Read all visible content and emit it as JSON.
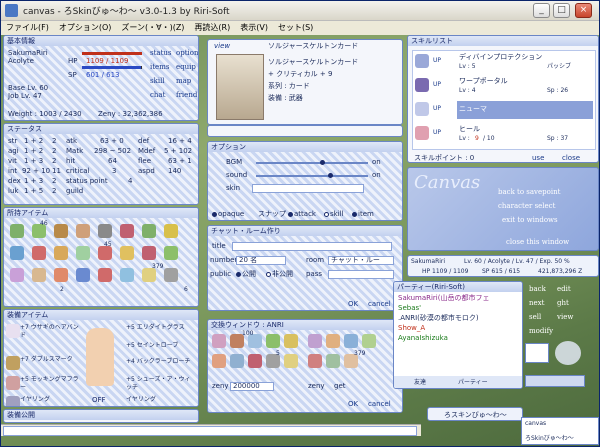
{
  "window": {
    "title": "canvas - ろSkinびゅ〜わ〜 v3.0-1.3 by Riri-Soft",
    "min": "_",
    "max": "□",
    "close": "×"
  },
  "menu": [
    "ファイル(F)",
    "オプション(O)",
    "ズーン(・∀・)(Z)",
    "再読込(R)",
    "表示(V)",
    "セット(S)"
  ],
  "basic": {
    "title": "基本情報",
    "name": "SakumaRiri",
    "job": "Acolyte",
    "hp_label": "HP",
    "hp": "1109 / 1109",
    "sp_label": "SP",
    "sp": "601 / 613",
    "base_lv": "Base Lv. 60",
    "job_lv": "Job Lv. 47",
    "weight": "Weight : 1003 / 2430",
    "zeny": "Zeny : 32,362,386",
    "hp_ratio": 1.0,
    "sp_ratio": 0.98,
    "buttons": [
      "status",
      "option",
      "items",
      "equip",
      "skill",
      "map",
      "chat",
      "friend"
    ]
  },
  "status": {
    "title": "ステータス",
    "rows": [
      [
        "str",
        "1 + 2",
        "2",
        "atk",
        "63 + 0",
        "def",
        "16 + 4"
      ],
      [
        "agi",
        "1 + 2",
        "2",
        "Matk",
        "298 ~ 502",
        "Mdef",
        "5 + 102"
      ],
      [
        "vit",
        "1 + 3",
        "2",
        "hit",
        "64",
        "flee",
        "63 + 1"
      ],
      [
        "int",
        "92 + 10",
        "11",
        "critical",
        "3",
        "aspd",
        "140"
      ],
      [
        "dex",
        "1 + 3",
        "2",
        "status point",
        "4",
        "",
        ""
      ],
      [
        "luk",
        "1 + 5",
        "2",
        "guild",
        "",
        "",
        ""
      ]
    ]
  },
  "inventory": {
    "title": "所持アイテム",
    "counts": [
      "46",
      "45",
      "379",
      "2",
      "6"
    ]
  },
  "equip": {
    "title": "装備アイテム",
    "left": [
      "+7 ウサギのヘアバンド",
      "+7 ダブルスマーク",
      "+5 モッキングマフラー",
      "イヤリング"
    ],
    "right": [
      "+5 エリダイトグラス",
      "+5 セイントローブ",
      "+4 バックラーブローチ",
      "+5 シューズ・ア・ウィッチ",
      "イヤリング"
    ],
    "off_label": "OFF"
  },
  "equip_public": {
    "title": "装備公開"
  },
  "card": {
    "view": "view",
    "title": "ソルジャースケルトンカード",
    "name": "ソルジャースケルトンカード",
    "effect": "+ クリティカル + 9",
    "series": "系列 : カード",
    "slot": "装備 : 武器"
  },
  "options": {
    "title": "オプション",
    "bgm": "BGM",
    "sound": "sound",
    "skin": "skin",
    "on": "on",
    "opaque": "opaque",
    "snap": "スナップ",
    "attack": "attack",
    "skill": "skill",
    "item": "item"
  },
  "chatroom": {
    "title": "チャット・ルーム作り",
    "title_label": "title",
    "number_label": "number",
    "number_value": "20 名",
    "room_label": "room",
    "room_value": "チャット・ルー",
    "public_label": "public",
    "public_opt": "公開",
    "private_opt": "非公開",
    "pass_label": "pass",
    "ok": "OK",
    "cancel": "cancel"
  },
  "trade": {
    "title": "交換ウィンドウ : ANRI",
    "zeny_label": "zeny",
    "zeny_value": "200000",
    "zeny_label2": "zeny",
    "get_label": "get",
    "ok": "OK",
    "cancel": "cancel",
    "counts": [
      "100",
      "5",
      "379"
    ]
  },
  "skills": {
    "title": "スキルリスト",
    "up": "UP",
    "items": [
      {
        "name": "ディバインプロテクション",
        "lv": "Lv : 5",
        "sp": "パッシブ",
        "icon": "shield-icon"
      },
      {
        "name": "ワープポータル",
        "lv": "Lv : 4",
        "sp": "Sp : 26",
        "icon": "portal-icon"
      },
      {
        "name": "ニューマ",
        "lv": "",
        "sp": "",
        "icon": "pneuma-icon"
      },
      {
        "name": "ヒール",
        "lv": "Lv :",
        "lv_cur": "9",
        "lv_max": "/ 10",
        "sp": "Sp : 37",
        "icon": "heal-icon"
      }
    ],
    "points": "スキルポイント : 0",
    "use": "use",
    "close": "close"
  },
  "canvas_menu": {
    "art": "Canvas",
    "items": [
      "back to savepoint",
      "character select",
      "exit to windows"
    ],
    "close": "close this window"
  },
  "summary": {
    "name": "SakumaRiri",
    "levels": "Lv. 60 / Acolyte / Lv. 47 / Exp. 50 %",
    "hp": "HP 1109 / 1109",
    "sp": "SP 615 / 615",
    "zeny": "421,873,296 Z"
  },
  "party": {
    "title": "パーティー(Riri-Soft)",
    "members": [
      {
        "name": "SakumaRiri(山岳の都市フェ",
        "color": "#8a2a8a"
      },
      {
        "name": "Sebas'",
        "color": "#1a7a1a"
      },
      {
        "name": ".ANRI(砂漠の都市モロク)",
        "color": "#1a2a5a"
      },
      {
        "name": "Show_A",
        "color": "#c0301a"
      },
      {
        "name": "AyanaIshizuka",
        "color": "#1a7a1a"
      }
    ],
    "friends": "友達",
    "party_tab": "パーティー"
  },
  "side_buttons": [
    "back",
    "edit",
    "next",
    "ght",
    "sell",
    "view",
    "modify"
  ],
  "minimized": {
    "label": "ろスキンびゅ〜わ〜"
  },
  "chat": {
    "name": "canvas",
    "sub": "ろSkinびゅ〜わ〜"
  },
  "colors": {
    "accent": "#6a86c6",
    "panel": "#f4f6fb",
    "hp": "#c0301a",
    "sp": "#2a4ac4"
  }
}
